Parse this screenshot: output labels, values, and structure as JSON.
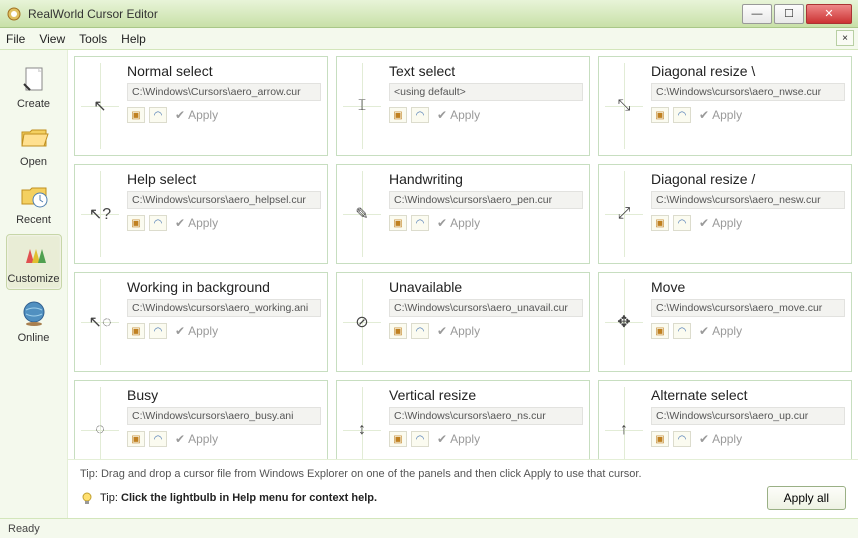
{
  "window": {
    "title": "RealWorld Cursor Editor"
  },
  "menu": {
    "file": "File",
    "view": "View",
    "tools": "Tools",
    "help": "Help"
  },
  "sidebar": {
    "items": [
      {
        "label": "Create"
      },
      {
        "label": "Open"
      },
      {
        "label": "Recent"
      },
      {
        "label": "Customize"
      },
      {
        "label": "Online"
      }
    ]
  },
  "apply_label": "Apply",
  "panels": [
    {
      "title": "Normal select",
      "path": "C:\\Windows\\Cursors\\aero_arrow.cur"
    },
    {
      "title": "Text select",
      "path": "<using default>"
    },
    {
      "title": "Diagonal resize \\",
      "path": "C:\\Windows\\cursors\\aero_nwse.cur"
    },
    {
      "title": "Help select",
      "path": "C:\\Windows\\cursors\\aero_helpsel.cur"
    },
    {
      "title": "Handwriting",
      "path": "C:\\Windows\\cursors\\aero_pen.cur"
    },
    {
      "title": "Diagonal resize /",
      "path": "C:\\Windows\\cursors\\aero_nesw.cur"
    },
    {
      "title": "Working in background",
      "path": "C:\\Windows\\cursors\\aero_working.ani"
    },
    {
      "title": "Unavailable",
      "path": "C:\\Windows\\cursors\\aero_unavail.cur"
    },
    {
      "title": "Move",
      "path": "C:\\Windows\\cursors\\aero_move.cur"
    },
    {
      "title": "Busy",
      "path": "C:\\Windows\\cursors\\aero_busy.ani"
    },
    {
      "title": "Vertical resize",
      "path": "C:\\Windows\\cursors\\aero_ns.cur"
    },
    {
      "title": "Alternate select",
      "path": "C:\\Windows\\cursors\\aero_up.cur"
    }
  ],
  "footer": {
    "tip1": "Tip: Drag and drop a cursor file from Windows Explorer on one of the panels and then click Apply to use that cursor.",
    "tip2_prefix": "Tip: ",
    "tip2_bold": "Click the lightbulb in Help menu for context help.",
    "apply_all": "Apply all"
  },
  "status": "Ready"
}
